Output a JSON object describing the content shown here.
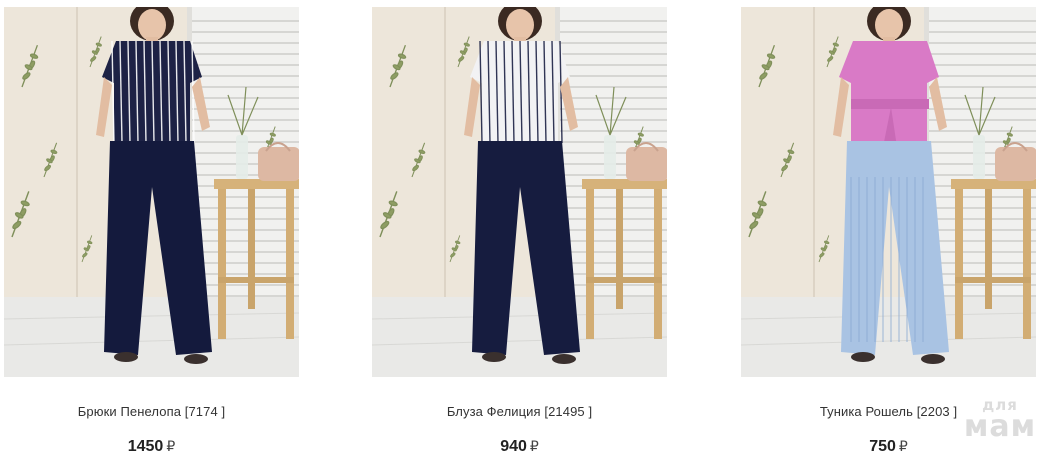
{
  "products": [
    {
      "name": "Брюки Пенелопа [7174 ]",
      "price": "1450",
      "currency": "₽",
      "photo": {
        "top_color": "#1d2245",
        "top_stripes": "#ffffff",
        "pants_color": "#141a3d",
        "has_belt": false,
        "pants_stripes": false
      }
    },
    {
      "name": "Блуза Фелиция [21495 ]",
      "price": "940",
      "currency": "₽",
      "photo": {
        "top_color": "#f2f2f4",
        "top_stripes": "#1c2144",
        "pants_color": "#161c3f",
        "has_belt": false,
        "pants_stripes": false
      }
    },
    {
      "name": "Туника Рошель [2203 ]",
      "price": "750",
      "currency": "₽",
      "photo": {
        "top_color": "#d97ac6",
        "top_stripes": "",
        "pants_color": "#a9c3e3",
        "has_belt": true,
        "pants_stripes": true
      }
    }
  ],
  "watermark": {
    "line1": "для",
    "line2": "мам"
  }
}
